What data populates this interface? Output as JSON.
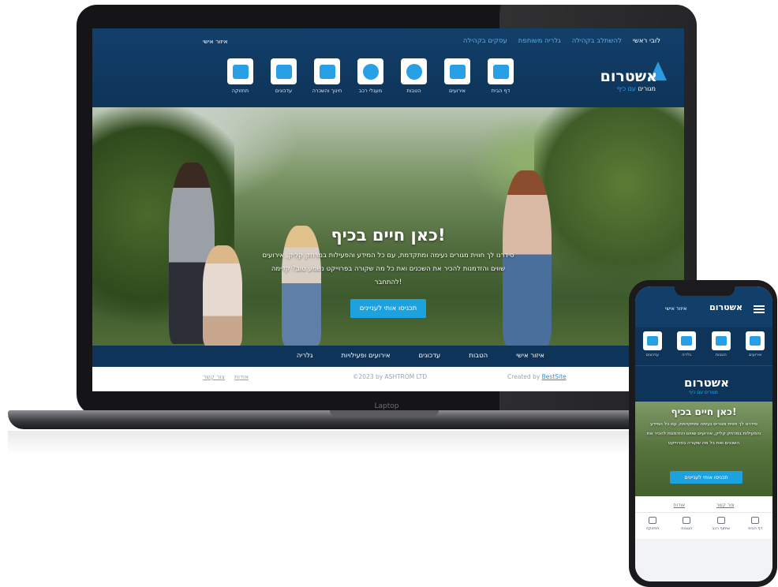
{
  "laptop": {
    "label": "Laptop",
    "nav": {
      "items": [
        "לובי ראשי",
        "להשתלב בקהילה",
        "גלריה משותפת",
        "עסקים בקהילה"
      ],
      "user_label": "איזור אישי"
    },
    "logo": {
      "title": "אשטרום",
      "sub_a": "מגורים",
      "sub_b": "עם כיף"
    },
    "icons": [
      {
        "label": "דף הבית",
        "icon": "home-icon"
      },
      {
        "label": "אירועים",
        "icon": "ticket-icon"
      },
      {
        "label": "הטבות",
        "icon": "heart-icon"
      },
      {
        "label": "מעגלי רכב",
        "icon": "car-icon"
      },
      {
        "label": "חינוך והשכרה",
        "icon": "megaphone-icon"
      },
      {
        "label": "עדכונים",
        "icon": "sparkle-icon"
      },
      {
        "label": "תחזוקה",
        "icon": "chat-icon"
      }
    ],
    "hero": {
      "title": "כאן חיים בכיף!",
      "body": "סידרנו לך חווית מגורים נעימה ומתקדמת, עם כל המידע והפעילות במרחק קליק, אירועים שווים והזדמנות להכיר את השכנים ואת כל מה שקורה בפרוייקט נשמע טוב? קדימה להתחבר!",
      "cta": "תכניסו אותי לעניינים"
    },
    "bottom_bar": [
      "איזור אישי",
      "הטבות",
      "עדכונים",
      "אירועים ופעילויות",
      "גלריה"
    ],
    "footer": {
      "credit_prefix": "Created by",
      "credit_link": "BestSite",
      "copyright": "©2023 by ASHTROM LTD",
      "links": [
        "צור קשר",
        "אודות"
      ]
    }
  },
  "phone": {
    "logo": "אשטרום",
    "user_label": "איזור אישי",
    "icons": [
      {
        "label": "אירועים",
        "icon": "ticket-icon"
      },
      {
        "label": "הטבות",
        "icon": "heart-icon"
      },
      {
        "label": "גלריה",
        "icon": "camera-icon"
      },
      {
        "label": "עדכונים",
        "icon": "sparkle-icon"
      }
    ],
    "logo_large": {
      "title": "אשטרום",
      "sub": "מגורים עם כיף"
    },
    "hero": {
      "title": "כאן חיים בכיף!",
      "body": "סידרנו לך חווית מגורים נעימה ומתקדמת, עם כל המידע והפעילות במרחק קליק, אירועים שווים והזדמנות להכיר את השכנים ואת כל מה שקורה בפרוייקט",
      "cta": "תכניסו אותי לעניינים"
    },
    "links": [
      "אודות",
      "צור קשר"
    ],
    "tabbar": [
      {
        "label": "דף הבית",
        "icon": "home-icon"
      },
      {
        "label": "שיתוף רכב",
        "icon": "car-icon"
      },
      {
        "label": "הטבות",
        "icon": "heart-icon"
      },
      {
        "label": "תחזוקה",
        "icon": "monitor-icon"
      }
    ]
  },
  "colors": {
    "header_navy": "#123f6a",
    "bar_navy": "#0e3459",
    "accent_blue": "#1da2e0",
    "icon_blue": "#28a0e5"
  }
}
